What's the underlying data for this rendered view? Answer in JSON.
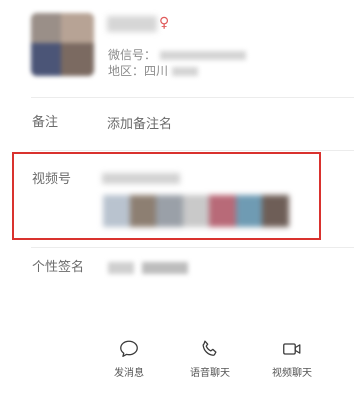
{
  "profile": {
    "wechat_id_label": "微信号：",
    "region_label": "地区：",
    "region_value": "四川"
  },
  "remark": {
    "label": "备注",
    "placeholder": "添加备注名"
  },
  "channels": {
    "label": "视频号",
    "highlight_color": "#d9322e"
  },
  "signature": {
    "label": "个性签名"
  },
  "actions": [
    {
      "label": "发消息",
      "icon": "chat-bubble-icon"
    },
    {
      "label": "语音聊天",
      "icon": "phone-icon"
    },
    {
      "label": "视频聊天",
      "icon": "video-camera-icon"
    }
  ],
  "colors": {
    "accent_red": "#d9322e",
    "label_gray": "#6b6b6b",
    "info_gray": "#8c8c8c"
  }
}
